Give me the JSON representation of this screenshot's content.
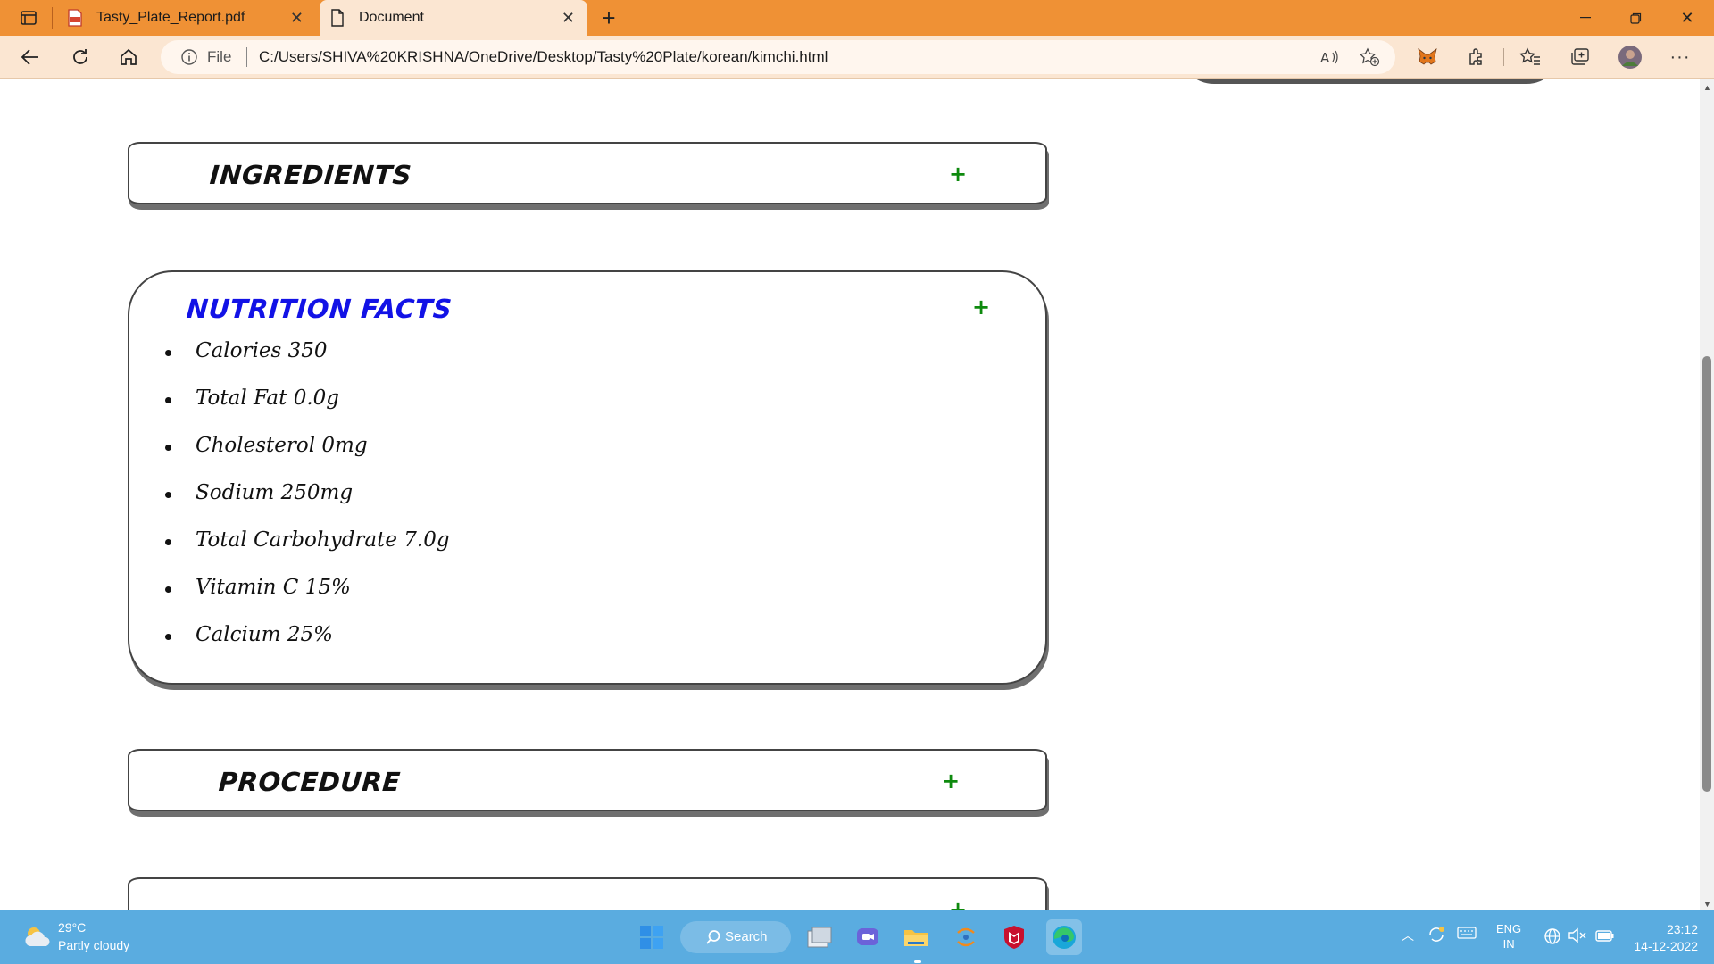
{
  "browser": {
    "tabs": [
      {
        "title": "Tasty_Plate_Report.pdf",
        "icon": "pdf-icon"
      },
      {
        "title": "Document",
        "icon": "document-icon",
        "active": true
      }
    ],
    "address": {
      "prefix": "File",
      "url": "C:/Users/SHIVA%20KRISHNA/OneDrive/Desktop/Tasty%20Plate/korean/kimchi.html"
    },
    "accent_color": "#ef9135"
  },
  "page": {
    "sections": {
      "ingredients": {
        "title": "INGREDIENTS",
        "toggle": "+"
      },
      "nutrition": {
        "title": "NUTRITION FACTS",
        "toggle": "+",
        "items": [
          "Calories 350",
          "Total Fat 0.0g",
          "Cholesterol 0mg",
          "Sodium 250mg",
          "Total Carbohydrate 7.0g",
          "Vitamin C 15%",
          "Calcium 25%"
        ]
      },
      "procedure": {
        "title": "PROCEDURE",
        "toggle": "+"
      },
      "expert": {
        "toggle": "+"
      }
    }
  },
  "taskbar": {
    "weather": {
      "temp": "29°C",
      "desc": "Partly cloudy"
    },
    "search_label": "Search",
    "language": {
      "line1": "ENG",
      "line2": "IN"
    },
    "clock": {
      "time": "23:12",
      "date": "14-12-2022"
    }
  }
}
